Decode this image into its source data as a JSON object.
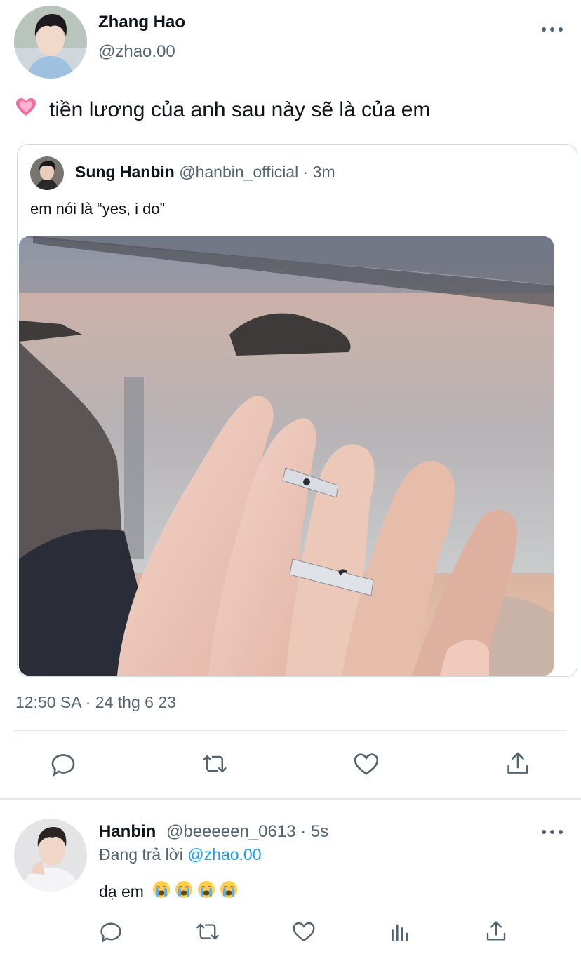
{
  "main_tweet": {
    "author_name": "Zhang Hao",
    "author_handle": "@zhao.00",
    "emoji_icon": "growing-heart-emoji",
    "text": "tiền lương của anh sau này sẽ là của em",
    "timestamp": "12:50 SA · 24 thg 6 23"
  },
  "quoted_tweet": {
    "author_name": "Sung Hanbin",
    "author_handle": "@hanbin_official",
    "time_sep": " · ",
    "time": "3m",
    "text": "em nói là “yes, i do”",
    "photo_icon": "couple-rings-photo"
  },
  "actions": [
    "reply-icon",
    "retweet-icon",
    "like-icon",
    "share-icon"
  ],
  "reply": {
    "author_name": "Hanbin",
    "author_handle": "@beeeeen_0613",
    "time_sep": " · ",
    "time": "5s",
    "replying_to_prefix": "Đang trả lời ",
    "replying_to_mention": "@zhao.00",
    "text": "dạ em",
    "emoji_icons": [
      "loudly-crying-face",
      "loudly-crying-face",
      "loudly-crying-face",
      "loudly-crying-face"
    ]
  },
  "reply_actions": [
    "reply-icon",
    "retweet-icon",
    "like-icon",
    "analytics-icon",
    "share-icon"
  ],
  "colors": {
    "text": "#0f1419",
    "secondary": "#536471",
    "link": "#1d9bf0",
    "border": "#cfd9de"
  }
}
